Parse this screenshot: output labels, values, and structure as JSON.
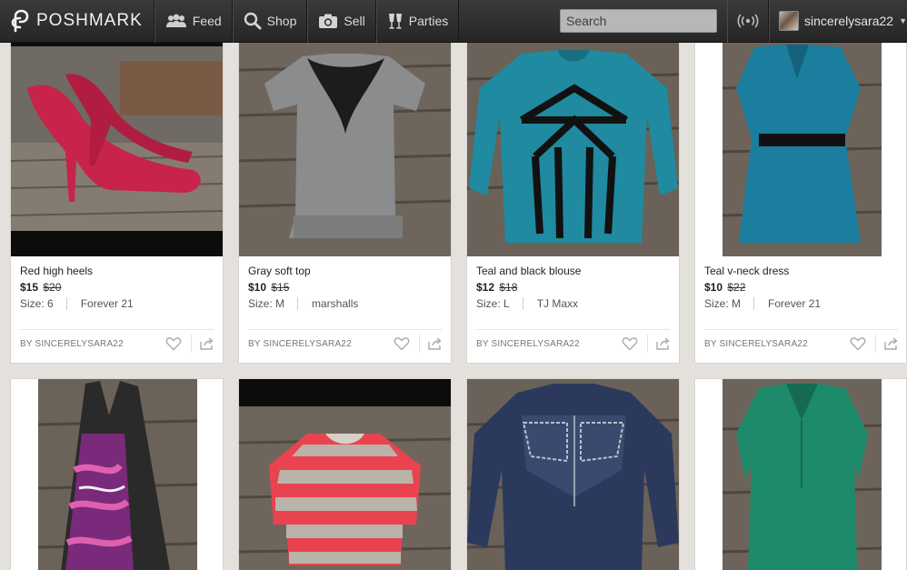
{
  "header": {
    "logo_text": "POSHMARK",
    "nav": {
      "feed": "Feed",
      "shop": "Shop",
      "sell": "Sell",
      "parties": "Parties"
    },
    "search_placeholder": "Search",
    "username": "sincerelysara22"
  },
  "listings": [
    {
      "title": "Red high heels",
      "price": "$15",
      "original_price": "$20",
      "size": "Size: 6",
      "brand": "Forever 21",
      "seller": "BY SINCERELYSARA22"
    },
    {
      "title": "Gray soft top",
      "price": "$10",
      "original_price": "$15",
      "size": "Size: M",
      "brand": "marshalls",
      "seller": "BY SINCERELYSARA22"
    },
    {
      "title": "Teal and black blouse",
      "price": "$12",
      "original_price": "$18",
      "size": "Size: L",
      "brand": "TJ Maxx",
      "seller": "BY SINCERELYSARA22"
    },
    {
      "title": "Teal v-neck dress",
      "price": "$10",
      "original_price": "$22",
      "size": "Size: M",
      "brand": "Forever 21",
      "seller": "BY SINCERELYSARA22"
    }
  ],
  "colors": {
    "header_bg": "#2e2e2e",
    "page_bg": "#e4e1dc",
    "card_bg": "#ffffff"
  }
}
